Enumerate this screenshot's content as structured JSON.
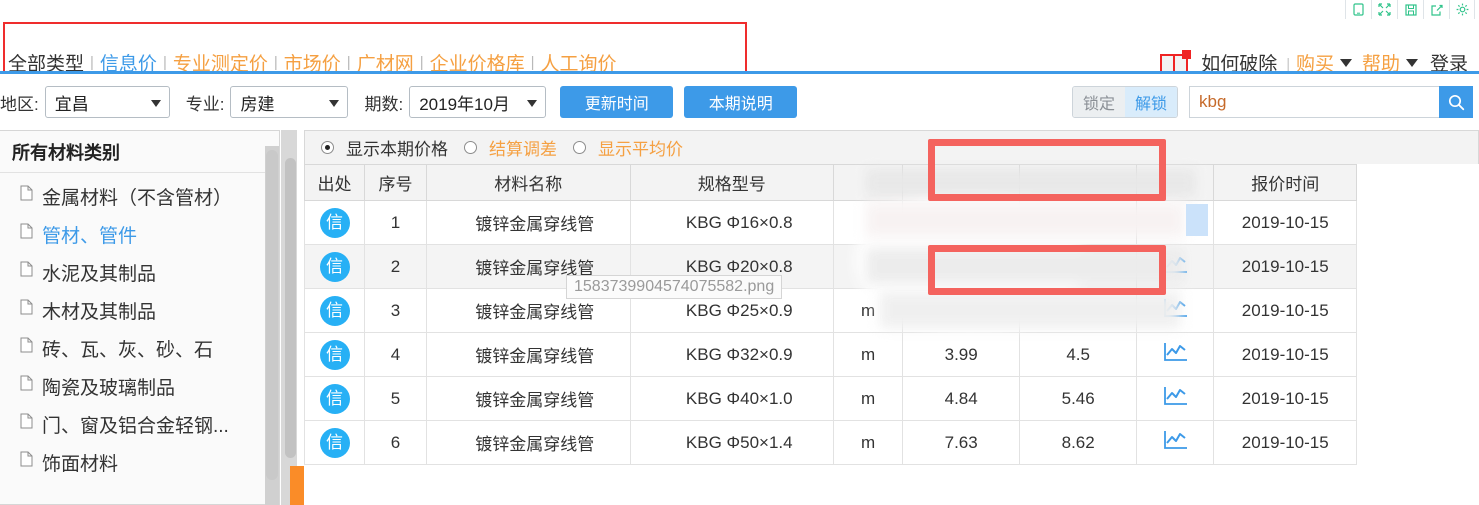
{
  "window_controls": [
    {
      "name": "mobile-view-icon",
      "label": "mobile"
    },
    {
      "name": "fullscreen-icon",
      "label": "fullscreen"
    },
    {
      "name": "save-icon",
      "label": "save"
    },
    {
      "name": "share-icon",
      "label": "share"
    },
    {
      "name": "settings-icon",
      "label": "settings"
    }
  ],
  "nav": {
    "items": [
      {
        "label": "全部类型",
        "style": "dark",
        "active": false
      },
      {
        "label": "信息价",
        "style": "blue",
        "active": true
      },
      {
        "label": "专业测定价",
        "style": "orange",
        "active": false
      },
      {
        "label": "市场价",
        "style": "orange",
        "active": false
      },
      {
        "label": "广材网",
        "style": "orange",
        "active": false
      },
      {
        "label": "企业价格库",
        "style": "orange",
        "active": false
      },
      {
        "label": "人工询价",
        "style": "orange",
        "active": false
      }
    ],
    "separator": "|"
  },
  "topright": {
    "promo_label": "如何破除",
    "separator": "|",
    "buy_label": "购买",
    "help_label": "帮助",
    "login_label": "登录"
  },
  "filters": {
    "region_label": "地区:",
    "region_value": "宜昌",
    "major_label": "专业:",
    "major_value": "房建",
    "period_label": "期数:",
    "period_value": "2019年10月",
    "update_time_button": "更新时间",
    "period_note_button": "本期说明"
  },
  "search": {
    "lock_label": "锁定",
    "unlock_label": "解锁",
    "value": "kbg",
    "placeholder": "",
    "search_icon": "search-icon"
  },
  "sidebar": {
    "title": "所有材料类别",
    "items": [
      {
        "label": "金属材料（不含管材）",
        "active": false
      },
      {
        "label": "管材、管件",
        "active": true
      },
      {
        "label": "水泥及其制品",
        "active": false
      },
      {
        "label": "木材及其制品",
        "active": false
      },
      {
        "label": "砖、瓦、灰、砂、石",
        "active": false
      },
      {
        "label": "陶瓷及玻璃制品",
        "active": false
      },
      {
        "label": "门、窗及铝合金轻钢...",
        "active": false
      },
      {
        "label": "饰面材料",
        "active": false
      }
    ]
  },
  "view_options": [
    {
      "label": "显示本期价格",
      "selected": true,
      "style": "dark"
    },
    {
      "label": "结算调差",
      "selected": false,
      "style": "orange"
    },
    {
      "label": "显示平均价",
      "selected": false,
      "style": "orange"
    }
  ],
  "table": {
    "headers": [
      {
        "label": "出处",
        "redacted": false
      },
      {
        "label": "序号",
        "redacted": false
      },
      {
        "label": "材料名称",
        "redacted": false
      },
      {
        "label": "规格型号",
        "redacted": false
      },
      {
        "label": "",
        "redacted": true
      },
      {
        "label": "",
        "redacted": true
      },
      {
        "label": "",
        "redacted": true
      },
      {
        "label": "",
        "redacted": true
      },
      {
        "label": "报价时间",
        "redacted": false
      }
    ],
    "rows": [
      {
        "source": "信",
        "no": "1",
        "name": "镀锌金属穿线管",
        "spec": "KBG Φ16×0.8",
        "unit": "",
        "price1": "",
        "price2": "",
        "chart": "",
        "date": "2019-10-15"
      },
      {
        "source": "信",
        "no": "2",
        "name": "镀锌金属穿线管",
        "spec": "KBG Φ20×0.8",
        "unit": "",
        "price1": "",
        "price2": "",
        "chart": "trend-chart-icon",
        "date": "2019-10-15"
      },
      {
        "source": "信",
        "no": "3",
        "name": "镀锌金属穿线管",
        "spec": "KBG Φ25×0.9",
        "unit": "m",
        "price1": "",
        "price2": "",
        "chart": "trend-chart-icon",
        "date": "2019-10-15"
      },
      {
        "source": "信",
        "no": "4",
        "name": "镀锌金属穿线管",
        "spec": "KBG Φ32×0.9",
        "unit": "m",
        "price1": "3.99",
        "price2": "4.5",
        "chart": "trend-chart-icon",
        "date": "2019-10-15"
      },
      {
        "source": "信",
        "no": "5",
        "name": "镀锌金属穿线管",
        "spec": "KBG Φ40×1.0",
        "unit": "m",
        "price1": "4.84",
        "price2": "5.46",
        "chart": "trend-chart-icon",
        "date": "2019-10-15"
      },
      {
        "source": "信",
        "no": "6",
        "name": "镀锌金属穿线管",
        "spec": "KBG Φ50×1.4",
        "unit": "m",
        "price1": "7.63",
        "price2": "8.62",
        "chart": "trend-chart-icon",
        "date": "2019-10-15"
      }
    ]
  },
  "tooltip": {
    "text": "1583739904574075582.png"
  },
  "colors": {
    "accent_blue": "#3d9ae8",
    "accent_orange": "#f5a042",
    "annotation_red": "#f4635e",
    "nav_box_red": "#ef2d2d",
    "source_badge_blue": "#27b0f5",
    "win_ctrl_green": "#2fc38a",
    "scroll_orange": "#fa8c28"
  }
}
